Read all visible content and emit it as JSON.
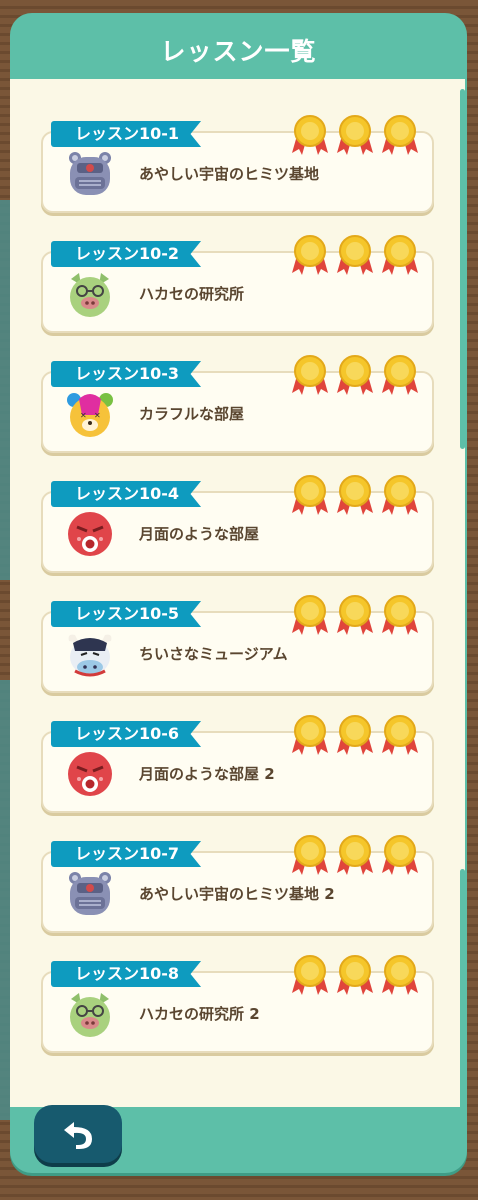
{
  "header": {
    "title": "レッスン一覧"
  },
  "lessons": [
    {
      "tag": "レッスン10-1",
      "name": "あやしい宇宙のヒミツ基地",
      "medals": 3,
      "avatar": "robot-icon"
    },
    {
      "tag": "レッスン10-2",
      "name": "ハカセの研究所",
      "medals": 3,
      "avatar": "pig-icon"
    },
    {
      "tag": "レッスン10-3",
      "name": "カラフルな部屋",
      "medals": 3,
      "avatar": "bear-icon"
    },
    {
      "tag": "レッスン10-4",
      "name": "月面のような部屋",
      "medals": 3,
      "avatar": "octopus-icon"
    },
    {
      "tag": "レッスン10-5",
      "name": "ちいさなミュージアム",
      "medals": 3,
      "avatar": "cow-icon"
    },
    {
      "tag": "レッスン10-6",
      "name": "月面のような部屋 2",
      "medals": 3,
      "avatar": "octopus-icon"
    },
    {
      "tag": "レッスン10-7",
      "name": "あやしい宇宙のヒミツ基地 2",
      "medals": 3,
      "avatar": "robot-icon"
    },
    {
      "tag": "レッスン10-8",
      "name": "ハカセの研究所 2",
      "medals": 3,
      "avatar": "pig-icon"
    }
  ],
  "colors": {
    "panel": "#5dbfa8",
    "tag": "#0e9bbf",
    "medal_gold": "#f5c62a",
    "ribbon": "#e0453c",
    "back_button": "#175a6e"
  },
  "footer": {
    "back_icon": "back-arrow-icon"
  }
}
